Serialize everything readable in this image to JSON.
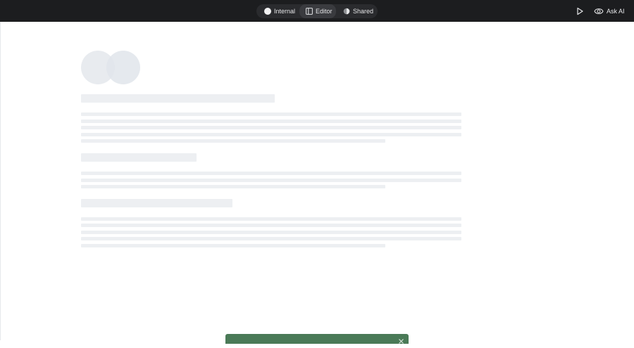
{
  "topbar": {
    "tabs": [
      {
        "label": "Internal",
        "icon": "internal-icon"
      },
      {
        "label": "Editor",
        "icon": "editor-icon",
        "active": true
      },
      {
        "label": "Shared",
        "icon": "shared-icon"
      }
    ],
    "ask_ai_label": "Ask AI"
  },
  "toast": {
    "close_icon": "close-icon"
  },
  "colors": {
    "topbar_bg": "#1c1d1f",
    "segmented_bg": "#2a2b2e",
    "active_tab_bg": "#3a3b3f",
    "skeleton": "#edeff2",
    "toast_bg": "#4a7a57"
  }
}
